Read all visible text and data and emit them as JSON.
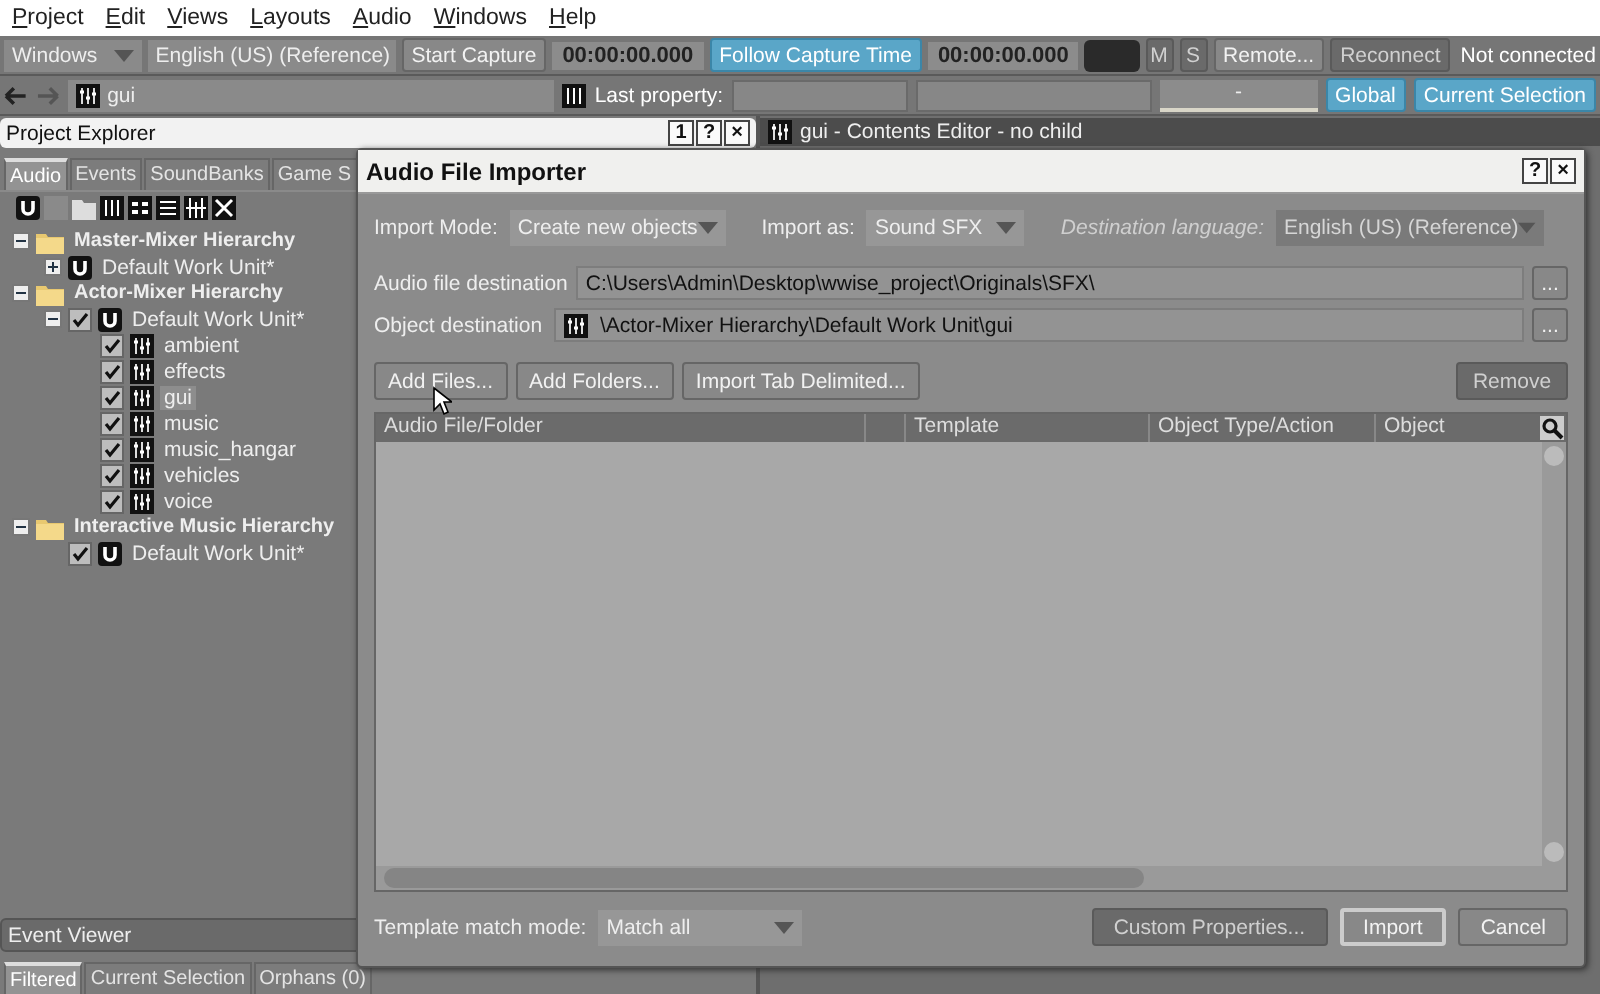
{
  "menu": [
    "Project",
    "Edit",
    "Views",
    "Layouts",
    "Audio",
    "Windows",
    "Help"
  ],
  "toolbar": {
    "platform": "Windows",
    "language": "English (US) (Reference)",
    "start_capture": "Start Capture",
    "time_1": "00:00:00.000",
    "follow_capture": {
      "label": "Follow Capture Time",
      "selected": true
    },
    "time_2": "00:00:00.000",
    "mute": {
      "label": "M",
      "disabled": true
    },
    "solo": {
      "label": "S",
      "disabled": true
    },
    "remote": {
      "label": "Remote...",
      "disabled": false
    },
    "reconnect": {
      "label": "Reconnect",
      "disabled": true
    },
    "status": "Not connected"
  },
  "selection_bar": {
    "object": "gui",
    "last_property_label": "Last property:",
    "slider_value": "-",
    "global": {
      "label": "Global",
      "selected": true
    },
    "current_selection": {
      "label": "Current Selection",
      "selected": true
    }
  },
  "project_explorer": {
    "title": "Project Explorer",
    "header_buttons": [
      "1",
      "?",
      "×"
    ],
    "tabs": [
      {
        "label": "Audio",
        "selected": true
      },
      {
        "label": "Events",
        "selected": false
      },
      {
        "label": "SoundBanks",
        "selected": false
      },
      {
        "label": "Game S",
        "selected": false
      }
    ],
    "tree": [
      {
        "kind": "folder",
        "label": "Master-Mixer Hierarchy",
        "expanded": true,
        "children": [
          {
            "kind": "work_unit",
            "label": "Default Work Unit*",
            "expanded": false
          }
        ]
      },
      {
        "kind": "folder",
        "label": "Actor-Mixer Hierarchy",
        "expanded": true,
        "children": [
          {
            "kind": "work_unit",
            "label": "Default Work Unit*",
            "expanded": true,
            "checked": true,
            "children": [
              {
                "kind": "actor_mixer",
                "label": "ambient",
                "checked": true,
                "selected": false
              },
              {
                "kind": "actor_mixer",
                "label": "effects",
                "checked": true,
                "selected": false
              },
              {
                "kind": "actor_mixer",
                "label": "gui",
                "checked": true,
                "selected": true
              },
              {
                "kind": "actor_mixer",
                "label": "music",
                "checked": true,
                "selected": false
              },
              {
                "kind": "actor_mixer",
                "label": "music_hangar",
                "checked": true,
                "selected": false
              },
              {
                "kind": "actor_mixer",
                "label": "vehicles",
                "checked": true,
                "selected": false
              },
              {
                "kind": "actor_mixer",
                "label": "voice",
                "checked": true,
                "selected": false
              }
            ]
          }
        ]
      },
      {
        "kind": "folder",
        "label": "Interactive Music Hierarchy",
        "expanded": true,
        "children": [
          {
            "kind": "work_unit",
            "label": "Default Work Unit*",
            "checked": true
          }
        ]
      }
    ]
  },
  "event_viewer": {
    "title": "Event Viewer",
    "tabs": [
      {
        "label": "Filtered",
        "selected": true
      },
      {
        "label": "Current Selection",
        "selected": false
      },
      {
        "label": "Orphans (0)",
        "selected": false
      }
    ]
  },
  "contents_editor": {
    "title": "gui - Contents Editor - no child"
  },
  "dialog": {
    "title": "Audio File Importer",
    "title_buttons": [
      "?",
      "×"
    ],
    "import_mode": {
      "label": "Import Mode:",
      "value": "Create new objects",
      "disabled": false
    },
    "import_as": {
      "label": "Import as:",
      "value": "Sound SFX",
      "disabled": false
    },
    "destination_language": {
      "label": "Destination language:",
      "value": "English (US) (Reference)",
      "disabled": true
    },
    "audio_file_destination": {
      "label": "Audio file destination",
      "value": "C:\\Users\\Admin\\Desktop\\wwise_project\\Originals\\SFX\\",
      "browse": "..."
    },
    "object_destination": {
      "label": "Object destination",
      "value": "\\Actor-Mixer Hierarchy\\Default Work Unit\\gui",
      "browse": "..."
    },
    "buttons": [
      {
        "label": "Add Files...",
        "disabled": false
      },
      {
        "label": "Add Folders...",
        "disabled": false
      },
      {
        "label": "Import Tab Delimited...",
        "disabled": false
      },
      {
        "label": "Remove",
        "disabled": true
      }
    ],
    "table": {
      "columns": [
        "Audio File/Folder",
        "",
        "Template",
        "Object Type/Action",
        "Object"
      ]
    },
    "template_match_mode": {
      "label": "Template match mode:",
      "value": "Match all"
    },
    "footer_buttons": [
      {
        "label": "Custom Properties...",
        "disabled": true,
        "default": false
      },
      {
        "label": "Import",
        "disabled": false,
        "default": true
      },
      {
        "label": "Cancel",
        "disabled": false,
        "default": false
      }
    ]
  }
}
